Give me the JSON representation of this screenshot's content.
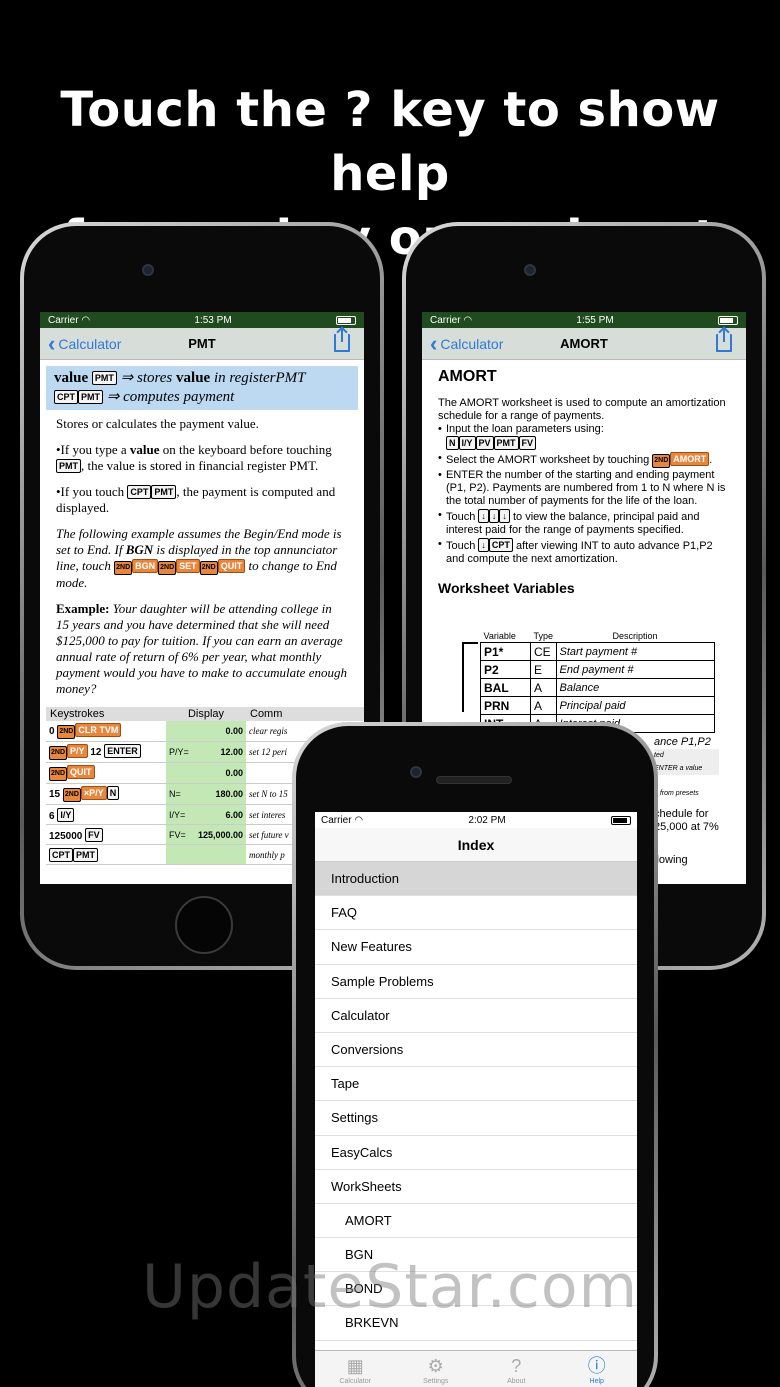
{
  "headline": {
    "line1": "Touch the ? key to show help",
    "line2": "for any key or workseet"
  },
  "phone_left": {
    "status": {
      "carrier": "Carrier",
      "time": "1:53 PM"
    },
    "nav": {
      "back": "Calculator",
      "title": "PMT"
    },
    "header": {
      "value": "value",
      "key_pmt": "PMT",
      "arrow1": "⇒ stores",
      "value2": "value",
      "in_reg": "in registerPMT",
      "key_cpt": "CPT",
      "arrow2": "⇒ computes payment"
    },
    "p1": "Stores or calculates the payment value.",
    "p2a": "•If you type a ",
    "p2b": "value",
    "p2c": " on the keyboard before touching ",
    "p2d": ", the value is stored in financial register PMT.",
    "p3a": "•If you touch ",
    "p3b": ", the payment is computed and displayed.",
    "p4a": "The following example assumes the Begin/End mode is set to End. If ",
    "p4b": "BGN",
    "p4c": " is displayed in the top annunciator line, touch ",
    "p4d": " to change to End mode.",
    "p5a": "Example:",
    "p5b": " Your daughter will be attending college in 15 years and you have determined that she will need $125,000 to pay for tuition. If you can earn an average annual rate of return of 6% per year, what monthly payment would you have to make to accumulate enough money?",
    "keys": {
      "k2nd": "2ND",
      "bgn": "BGN",
      "set": "SET",
      "quit": "QUIT"
    },
    "table": {
      "headers": [
        "Keystrokes",
        "Display",
        "Comm"
      ],
      "rows": [
        {
          "ks": "0",
          "k1": "2ND",
          "k2": "CLR TVM",
          "label": "",
          "value": "0.00",
          "comment": "clear regis"
        },
        {
          "ks": "",
          "k1": "2ND",
          "k2": "P/Y",
          "extra": "12",
          "k3": "ENTER",
          "label": "P/Y=",
          "value": "12.00",
          "comment": "set 12 peri"
        },
        {
          "ks": "",
          "k1": "2ND",
          "k2": "QUIT",
          "label": "",
          "value": "0.00",
          "comment": ""
        },
        {
          "ks": "15",
          "k1": "2ND",
          "k2": "×P/Y",
          "k3": "N",
          "label": "N=",
          "value": "180.00",
          "comment": "set N to 15"
        },
        {
          "ks": "6",
          "k1": "I/Y",
          "label": "I/Y=",
          "value": "6.00",
          "comment": "set interes"
        },
        {
          "ks": "125000",
          "k1": "FV",
          "label": "FV=",
          "value": "125,000.00",
          "comment": "set future v"
        },
        {
          "ks": "",
          "k1": "CPT",
          "k2": "PMT",
          "label": "",
          "value": "",
          "comment": "monthly p"
        }
      ]
    }
  },
  "phone_right": {
    "status": {
      "carrier": "Carrier",
      "time": "1:55 PM"
    },
    "nav": {
      "back": "Calculator",
      "title": "AMORT"
    },
    "title": "AMORT",
    "intro": "The AMORT worksheet is used to compute an amortization schedule for a range of payments.",
    "b1": "Input the loan parameters using:",
    "b1keys": [
      "N",
      "I/Y",
      "PV",
      "PMT",
      "FV"
    ],
    "b2a": "Select the AMORT worksheet by touching ",
    "b2k1": "2ND",
    "b2k2": "AMORT",
    "b2b": ".",
    "b3": "ENTER the number of the starting and ending payment (P1, P2). Payments are numbered from 1 to N where N is the total number of payments for the life of the loan.",
    "b4a": "Touch ",
    "b4keys": [
      "↓",
      "↓",
      "↓"
    ],
    "b4b": " to view the balance, principal paid and interest paid for the range of payments specified.",
    "b5a": "Touch ",
    "b5keys": [
      "↓",
      "CPT"
    ],
    "b5b": " after viewing INT to auto advance P1,P2 and compute the next amortization.",
    "section": "Worksheet Variables",
    "vt_headers": [
      "Variable",
      "Type",
      "Description"
    ],
    "vars": [
      {
        "v": "P1*",
        "t": "CE",
        "d": "Start payment #"
      },
      {
        "v": "P2",
        "t": "E",
        "d": "End payment #"
      },
      {
        "v": "BAL",
        "t": "A",
        "d": "Balance"
      },
      {
        "v": "PRN",
        "t": "A",
        "d": "Principal paid"
      },
      {
        "v": "INT",
        "t": "A",
        "d": "Interest paid"
      }
    ],
    "peek": {
      "a": "ance P1,P2",
      "b": "ted",
      "c": "ENTER a value",
      "d": "e from presets",
      "e": "chedule for",
      "f": "25,000 at 7%",
      "g": "llowing"
    }
  },
  "phone_front": {
    "status": {
      "carrier": "Carrier",
      "time": "2:02 PM"
    },
    "nav": {
      "title": "Index"
    },
    "items": [
      {
        "label": "Introduction",
        "selected": true,
        "sub": false
      },
      {
        "label": "FAQ",
        "selected": false,
        "sub": false
      },
      {
        "label": "New Features",
        "selected": false,
        "sub": false
      },
      {
        "label": "Sample Problems",
        "selected": false,
        "sub": false
      },
      {
        "label": "Calculator",
        "selected": false,
        "sub": false
      },
      {
        "label": "Conversions",
        "selected": false,
        "sub": false
      },
      {
        "label": "Tape",
        "selected": false,
        "sub": false
      },
      {
        "label": "Settings",
        "selected": false,
        "sub": false
      },
      {
        "label": "EasyCalcs",
        "selected": false,
        "sub": false
      },
      {
        "label": "WorkSheets",
        "selected": false,
        "sub": false
      },
      {
        "label": "AMORT",
        "selected": false,
        "sub": true
      },
      {
        "label": "BGN",
        "selected": false,
        "sub": true
      },
      {
        "label": "BOND",
        "selected": false,
        "sub": true
      },
      {
        "label": "BRKEVN",
        "selected": false,
        "sub": true
      }
    ],
    "tabs": [
      {
        "label": "Calculator",
        "icon": "calculator-icon",
        "glyph": "▦",
        "active": false
      },
      {
        "label": "Settings",
        "icon": "gear-icon",
        "glyph": "⚙",
        "active": false
      },
      {
        "label": "About",
        "icon": "question-icon",
        "glyph": "?",
        "active": false
      },
      {
        "label": "Help",
        "icon": "info-icon",
        "glyph": "ⓘ",
        "active": true
      }
    ]
  },
  "watermark": "UpdateStar.com",
  "colors": {
    "statusbar": "#1f4b1f",
    "accent": "#2f7ad7",
    "header_bg": "#bcd9f1",
    "display_bg": "#c3e8b6",
    "key_orange": "#e7873d"
  }
}
